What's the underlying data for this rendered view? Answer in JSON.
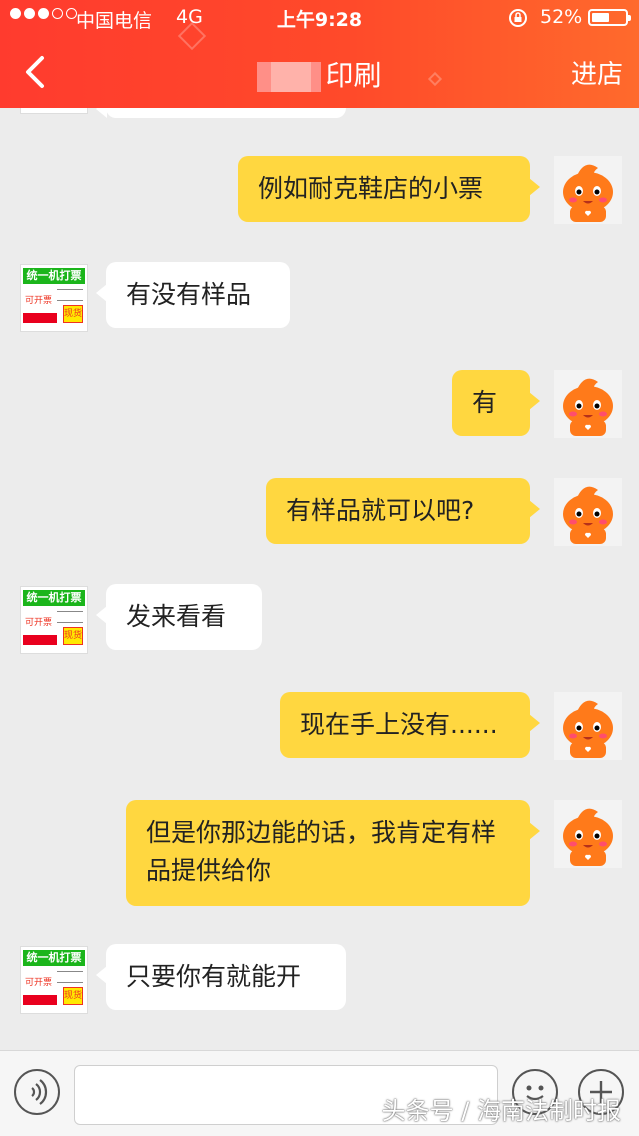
{
  "status_bar": {
    "carrier": "中国电信",
    "network": "4G",
    "time": "上午9:28",
    "battery": "52%",
    "battery_level": 0.52
  },
  "header": {
    "title": "印刷",
    "enter_store": "进店"
  },
  "messages": [
    {
      "side": "right",
      "text": "例如耐克鞋店的小票"
    },
    {
      "side": "left",
      "text": "有没有样品"
    },
    {
      "side": "right",
      "text": "有"
    },
    {
      "side": "right",
      "text": "有样品就可以吧?"
    },
    {
      "side": "left",
      "text": "发来看看"
    },
    {
      "side": "right",
      "text": "现在手上没有......"
    },
    {
      "side": "right",
      "text": "但是你那边能的话，我肯定有样品提供给你"
    },
    {
      "side": "left",
      "text": "只要你有就能开"
    }
  ],
  "shop_avatar": {
    "top_text": "统一机打票",
    "mid_text": "可开票",
    "badge": "现货"
  },
  "watermark": "头条号 / 海南法制时报",
  "colors": {
    "header": "#ff4a2a",
    "user_bubble": "#ffd740",
    "shop_bubble": "#ffffff",
    "background": "#ececec"
  }
}
